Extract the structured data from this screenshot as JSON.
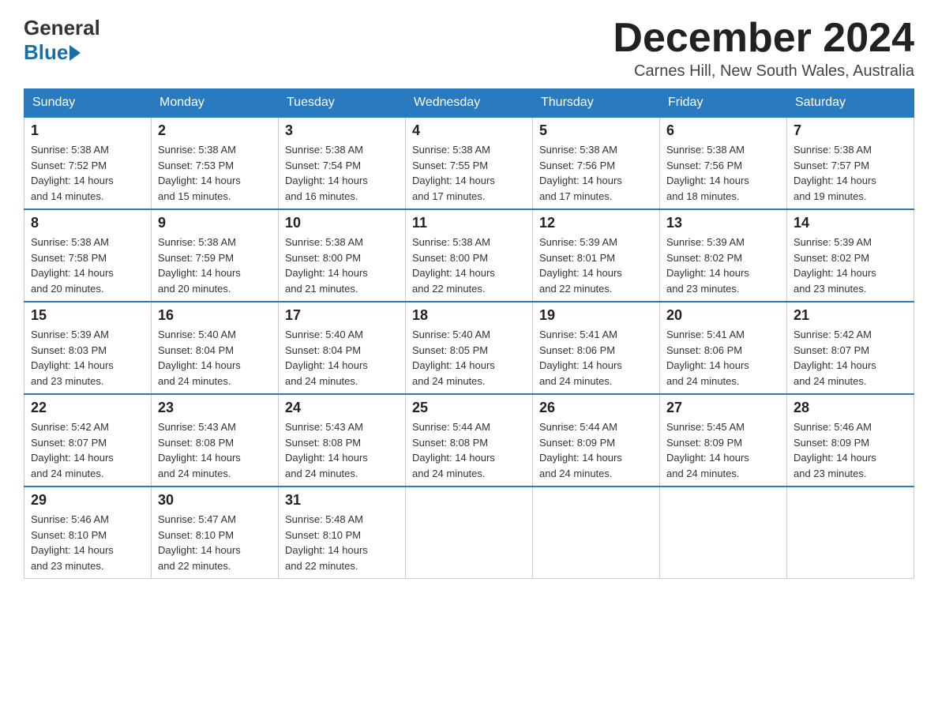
{
  "header": {
    "logo_line1": "General",
    "logo_line2": "Blue",
    "month_title": "December 2024",
    "location": "Carnes Hill, New South Wales, Australia"
  },
  "weekdays": [
    "Sunday",
    "Monday",
    "Tuesday",
    "Wednesday",
    "Thursday",
    "Friday",
    "Saturday"
  ],
  "weeks": [
    [
      {
        "day": "1",
        "sunrise": "5:38 AM",
        "sunset": "7:52 PM",
        "daylight": "14 hours and 14 minutes."
      },
      {
        "day": "2",
        "sunrise": "5:38 AM",
        "sunset": "7:53 PM",
        "daylight": "14 hours and 15 minutes."
      },
      {
        "day": "3",
        "sunrise": "5:38 AM",
        "sunset": "7:54 PM",
        "daylight": "14 hours and 16 minutes."
      },
      {
        "day": "4",
        "sunrise": "5:38 AM",
        "sunset": "7:55 PM",
        "daylight": "14 hours and 17 minutes."
      },
      {
        "day": "5",
        "sunrise": "5:38 AM",
        "sunset": "7:56 PM",
        "daylight": "14 hours and 17 minutes."
      },
      {
        "day": "6",
        "sunrise": "5:38 AM",
        "sunset": "7:56 PM",
        "daylight": "14 hours and 18 minutes."
      },
      {
        "day": "7",
        "sunrise": "5:38 AM",
        "sunset": "7:57 PM",
        "daylight": "14 hours and 19 minutes."
      }
    ],
    [
      {
        "day": "8",
        "sunrise": "5:38 AM",
        "sunset": "7:58 PM",
        "daylight": "14 hours and 20 minutes."
      },
      {
        "day": "9",
        "sunrise": "5:38 AM",
        "sunset": "7:59 PM",
        "daylight": "14 hours and 20 minutes."
      },
      {
        "day": "10",
        "sunrise": "5:38 AM",
        "sunset": "8:00 PM",
        "daylight": "14 hours and 21 minutes."
      },
      {
        "day": "11",
        "sunrise": "5:38 AM",
        "sunset": "8:00 PM",
        "daylight": "14 hours and 22 minutes."
      },
      {
        "day": "12",
        "sunrise": "5:39 AM",
        "sunset": "8:01 PM",
        "daylight": "14 hours and 22 minutes."
      },
      {
        "day": "13",
        "sunrise": "5:39 AM",
        "sunset": "8:02 PM",
        "daylight": "14 hours and 23 minutes."
      },
      {
        "day": "14",
        "sunrise": "5:39 AM",
        "sunset": "8:02 PM",
        "daylight": "14 hours and 23 minutes."
      }
    ],
    [
      {
        "day": "15",
        "sunrise": "5:39 AM",
        "sunset": "8:03 PM",
        "daylight": "14 hours and 23 minutes."
      },
      {
        "day": "16",
        "sunrise": "5:40 AM",
        "sunset": "8:04 PM",
        "daylight": "14 hours and 24 minutes."
      },
      {
        "day": "17",
        "sunrise": "5:40 AM",
        "sunset": "8:04 PM",
        "daylight": "14 hours and 24 minutes."
      },
      {
        "day": "18",
        "sunrise": "5:40 AM",
        "sunset": "8:05 PM",
        "daylight": "14 hours and 24 minutes."
      },
      {
        "day": "19",
        "sunrise": "5:41 AM",
        "sunset": "8:06 PM",
        "daylight": "14 hours and 24 minutes."
      },
      {
        "day": "20",
        "sunrise": "5:41 AM",
        "sunset": "8:06 PM",
        "daylight": "14 hours and 24 minutes."
      },
      {
        "day": "21",
        "sunrise": "5:42 AM",
        "sunset": "8:07 PM",
        "daylight": "14 hours and 24 minutes."
      }
    ],
    [
      {
        "day": "22",
        "sunrise": "5:42 AM",
        "sunset": "8:07 PM",
        "daylight": "14 hours and 24 minutes."
      },
      {
        "day": "23",
        "sunrise": "5:43 AM",
        "sunset": "8:08 PM",
        "daylight": "14 hours and 24 minutes."
      },
      {
        "day": "24",
        "sunrise": "5:43 AM",
        "sunset": "8:08 PM",
        "daylight": "14 hours and 24 minutes."
      },
      {
        "day": "25",
        "sunrise": "5:44 AM",
        "sunset": "8:08 PM",
        "daylight": "14 hours and 24 minutes."
      },
      {
        "day": "26",
        "sunrise": "5:44 AM",
        "sunset": "8:09 PM",
        "daylight": "14 hours and 24 minutes."
      },
      {
        "day": "27",
        "sunrise": "5:45 AM",
        "sunset": "8:09 PM",
        "daylight": "14 hours and 24 minutes."
      },
      {
        "day": "28",
        "sunrise": "5:46 AM",
        "sunset": "8:09 PM",
        "daylight": "14 hours and 23 minutes."
      }
    ],
    [
      {
        "day": "29",
        "sunrise": "5:46 AM",
        "sunset": "8:10 PM",
        "daylight": "14 hours and 23 minutes."
      },
      {
        "day": "30",
        "sunrise": "5:47 AM",
        "sunset": "8:10 PM",
        "daylight": "14 hours and 22 minutes."
      },
      {
        "day": "31",
        "sunrise": "5:48 AM",
        "sunset": "8:10 PM",
        "daylight": "14 hours and 22 minutes."
      },
      null,
      null,
      null,
      null
    ]
  ],
  "labels": {
    "sunrise": "Sunrise:",
    "sunset": "Sunset:",
    "daylight": "Daylight:"
  }
}
